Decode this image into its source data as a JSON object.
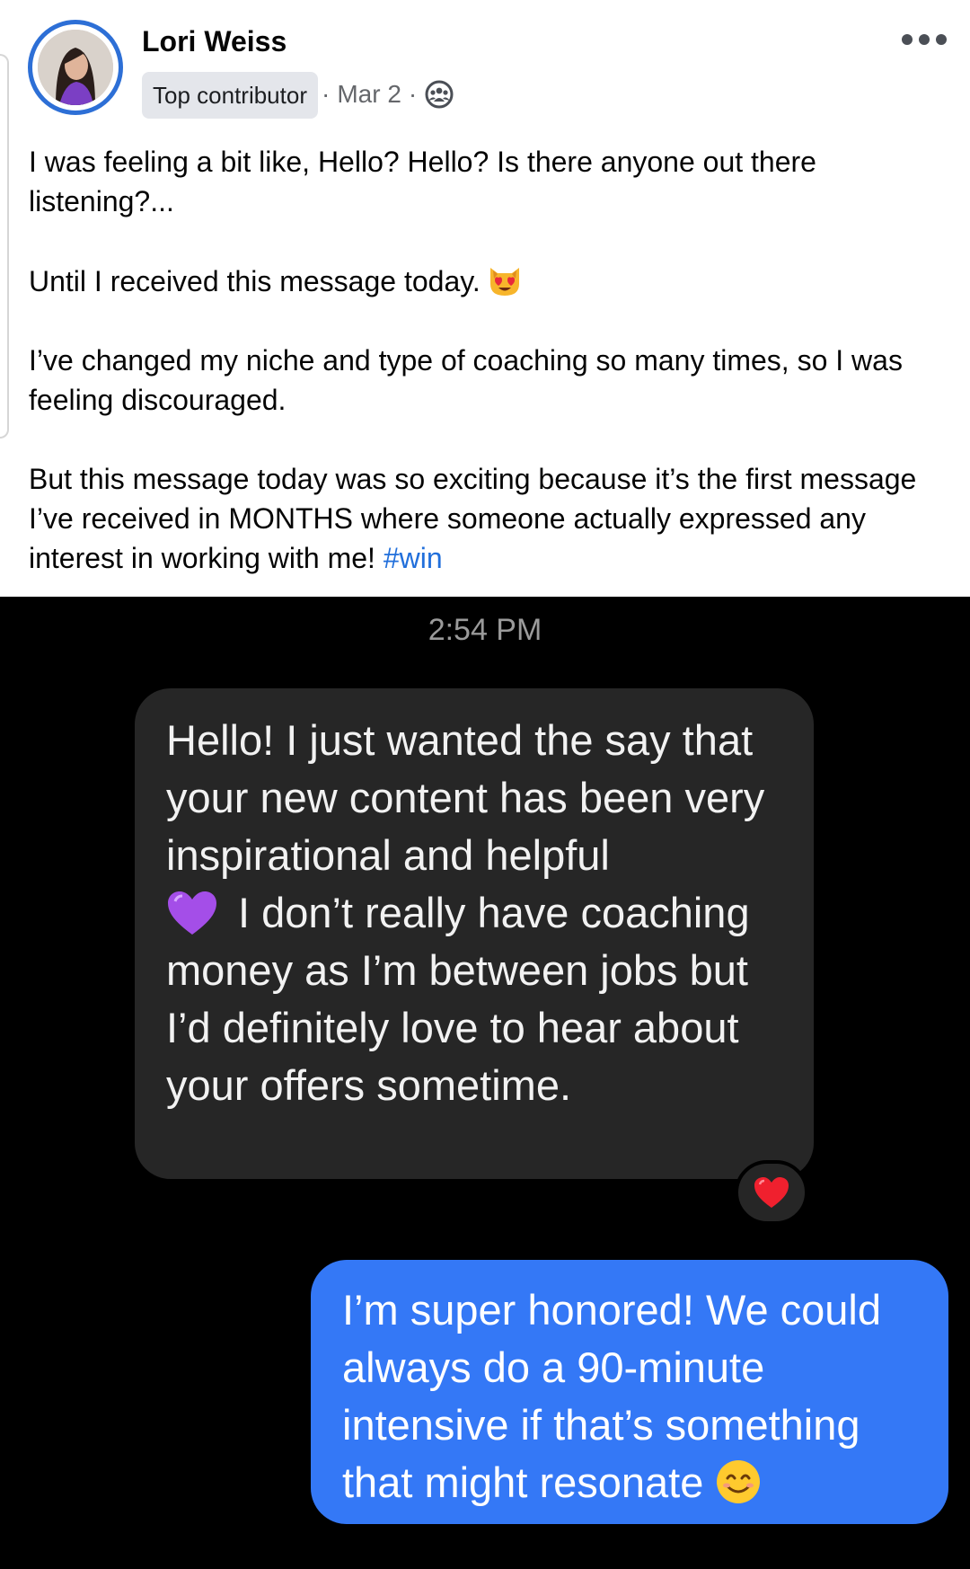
{
  "post": {
    "author_name": "Lori Weiss",
    "badge": "Top contributor",
    "date": "Mar 2",
    "separator": "·",
    "icons": {
      "audience": "group-audience-icon",
      "more": "more-options-icon",
      "avatar": "avatar"
    },
    "paragraphs": {
      "p1": "I was feeling a bit like, Hello? Hello? Is there anyone out there listening?...",
      "p2": "Until I received this message today.",
      "p2_emoji": "heart-eyes-cat-emoji",
      "p3": "I’ve changed my niche and type of coaching so many times, so I was feeling discouraged.",
      "p4": "But this message today was so exciting because it’s the first message I’ve received in MONTHS where someone actually expressed any interest in working with me!",
      "hashtag": "#win"
    },
    "colors": {
      "avatar_ring": "#2d6fd6",
      "hashtag": "#216fdb",
      "meta_text": "#65676b"
    }
  },
  "screenshot": {
    "timestamp": "2:54 PM",
    "incoming": {
      "text_before_emoji": "Hello! I just wanted the say that your new content has been very inspirational and helpful",
      "emoji": "purple-heart-emoji",
      "text_after_emoji": "I don’t really have coaching money as I’m between jobs but I’d definitely love to hear about your offers sometime.",
      "reaction": "red-heart-reaction"
    },
    "outgoing": {
      "text": "I’m super honored! We could always do a 90-minute intensive if that’s something that might resonate",
      "emoji": "smiling-face-emoji"
    },
    "colors": {
      "background": "#000000",
      "incoming_bubble": "#262626",
      "outgoing_bubble": "#3478f6"
    }
  }
}
